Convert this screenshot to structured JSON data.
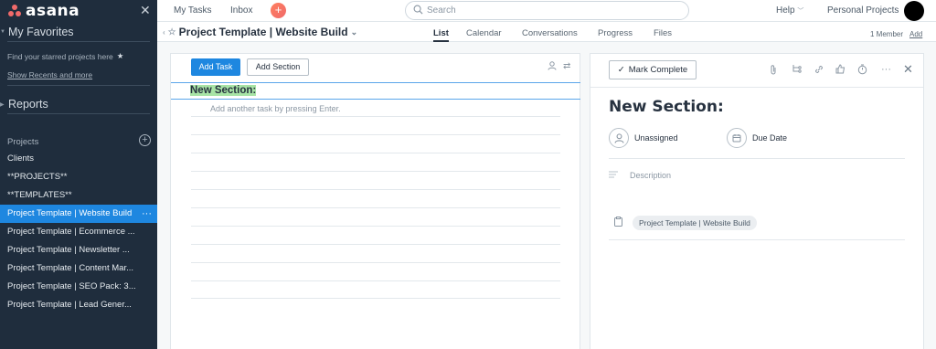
{
  "app": {
    "brand": "asana"
  },
  "sidebar": {
    "favorites_title": "My Favorites",
    "favorites_hint": "Find your starred projects here",
    "show_recents": "Show Recents and more",
    "reports_title": "Reports",
    "projects_label": "Projects",
    "projects": [
      {
        "label": "Clients",
        "active": false
      },
      {
        "label": "**PROJECTS**",
        "active": false
      },
      {
        "label": "**TEMPLATES**",
        "active": false
      },
      {
        "label": "Project Template | Website Build",
        "active": true
      },
      {
        "label": "Project Template | Ecommerce ...",
        "active": false
      },
      {
        "label": "Project Template | Newsletter ...",
        "active": false
      },
      {
        "label": "Project Template | Content Mar...",
        "active": false
      },
      {
        "label": "Project Template | SEO Pack: 3...",
        "active": false
      },
      {
        "label": "Project Template | Lead Gener...",
        "active": false
      }
    ]
  },
  "topbar": {
    "my_tasks": "My Tasks",
    "inbox": "Inbox",
    "search_placeholder": "Search",
    "help": "Help",
    "workspace": "Personal Projects"
  },
  "project": {
    "title": "Project Template | Website Build",
    "tabs": [
      "List",
      "Calendar",
      "Conversations",
      "Progress",
      "Files"
    ],
    "active_tab": "List",
    "members": "1 Member",
    "add": "Add"
  },
  "task_list": {
    "add_task": "Add Task",
    "add_section": "Add Section",
    "section_title": "New Section:",
    "add_another": "Add another task by pressing Enter."
  },
  "detail": {
    "mark_complete": "Mark Complete",
    "title": "New Section:",
    "assignee": "Unassigned",
    "due_date": "Due Date",
    "description_placeholder": "Description",
    "project_tag": "Project Template | Website Build"
  },
  "colors": {
    "sidebar_bg": "#1f2d3d",
    "accent": "#1e87e0",
    "highlight": "#a8e4a6",
    "brand_coral": "#f06a6a"
  }
}
